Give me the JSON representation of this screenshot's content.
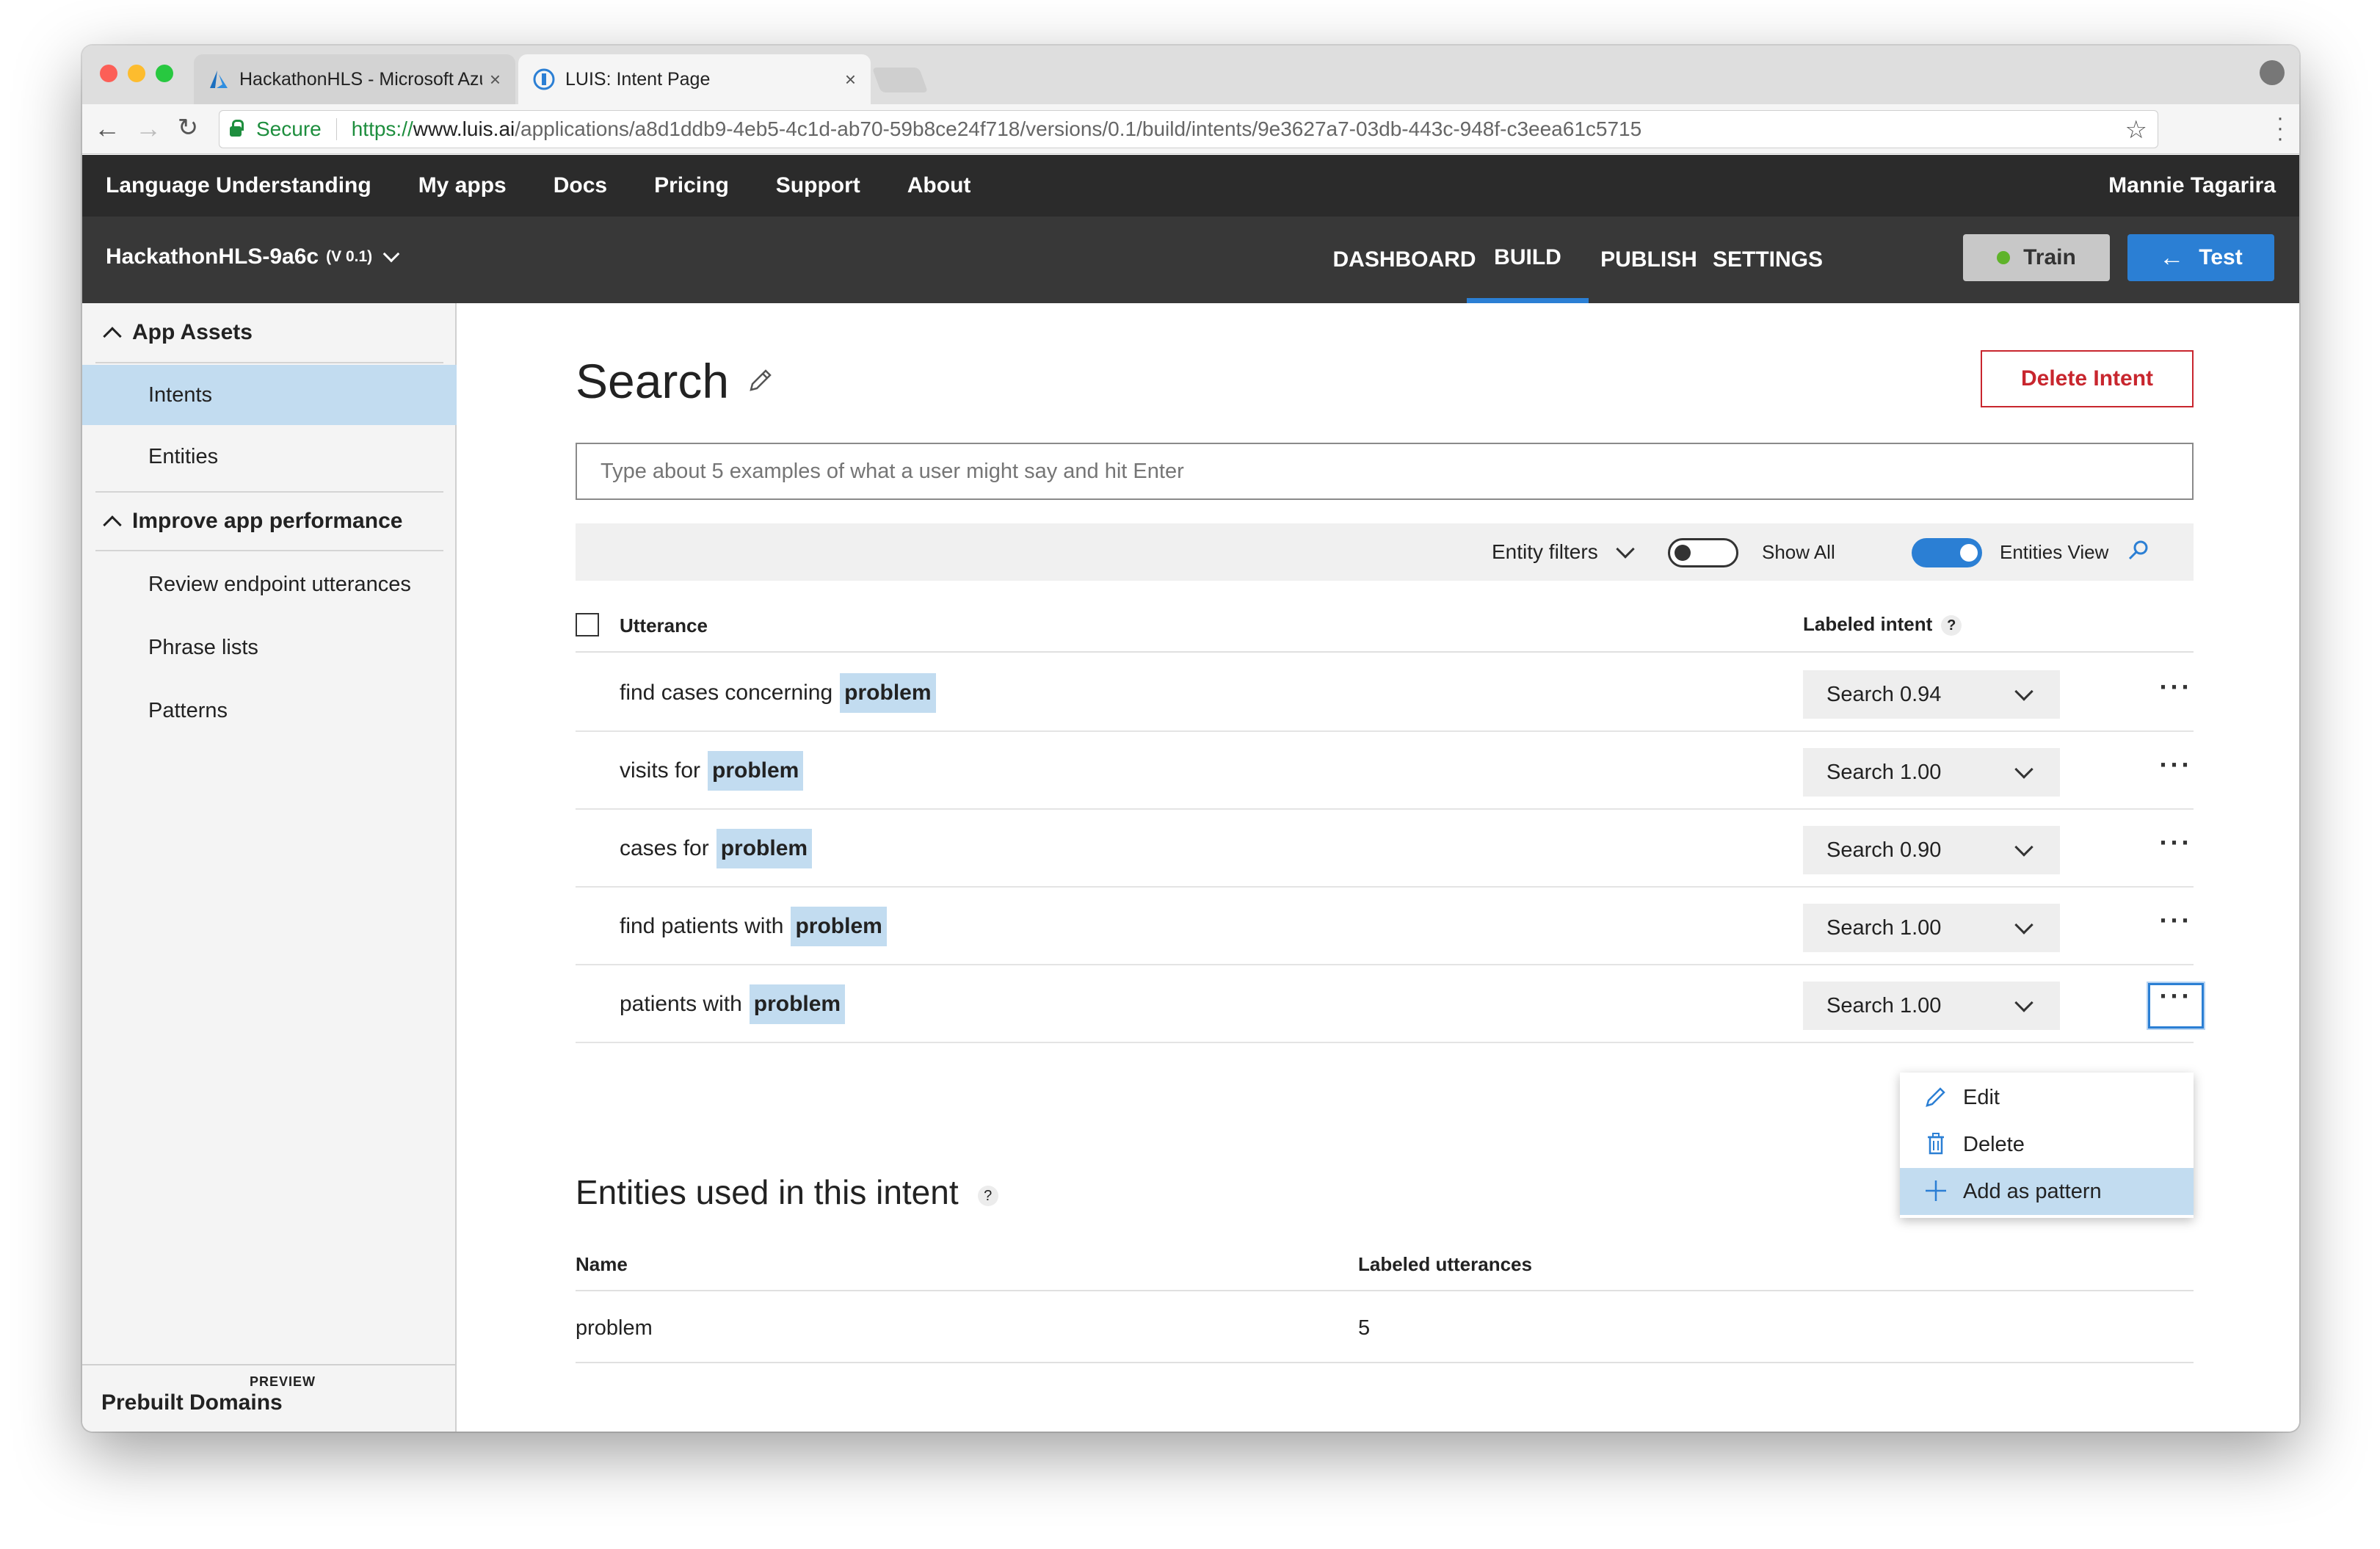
{
  "browser": {
    "tabs": [
      {
        "title": "HackathonHLS - Microsoft Azu",
        "icon": "azure-icon",
        "active": false
      },
      {
        "title": "LUIS: Intent Page",
        "icon": "luis-icon",
        "active": true
      }
    ],
    "close_glyph": "×",
    "secure_label": "Secure",
    "url": {
      "scheme": "https://",
      "host": "www.luis.ai",
      "path": "/applications/a8d1ddb9-4eb5-4c1d-ab70-59b8ce24f718/versions/0.1/build/intents/9e3627a7-03db-443c-948f-c3eea61c5715"
    },
    "star_glyph": "☆"
  },
  "topnav": {
    "items": [
      "Language Understanding",
      "My apps",
      "Docs",
      "Pricing",
      "Support",
      "About"
    ],
    "user": "Mannie Tagarira"
  },
  "subnav": {
    "app_name": "HackathonHLS-9a6c",
    "version": "(V 0.1)",
    "items": [
      "DASHBOARD",
      "BUILD",
      "PUBLISH",
      "SETTINGS"
    ],
    "active_item": "BUILD",
    "train_label": "Train",
    "test_label": "Test",
    "test_arrow": "←"
  },
  "sidebar": {
    "sections": [
      {
        "label": "App Assets",
        "items": [
          "Intents",
          "Entities"
        ]
      },
      {
        "label": "Improve app performance",
        "items": [
          "Review endpoint utterances",
          "Phrase lists",
          "Patterns"
        ]
      }
    ],
    "active_item": "Intents",
    "footer_label": "Prebuilt Domains",
    "footer_badge": "PREVIEW"
  },
  "main": {
    "title": "Search",
    "delete_button": "Delete Intent",
    "input_placeholder": "Type about 5 examples of what a user might say and hit Enter",
    "filters": {
      "entity_filters": "Entity filters",
      "show_all": "Show All",
      "show_all_on": false,
      "entities_view": "Entities View",
      "entities_view_on": true
    },
    "table": {
      "col_utterance": "Utterance",
      "col_intent": "Labeled intent",
      "help_glyph": "?",
      "ellipsis": "···",
      "rows": [
        {
          "text": "find cases concerning",
          "entity": "problem",
          "intent": "Search 0.94"
        },
        {
          "text": "visits for",
          "entity": "problem",
          "intent": "Search 1.00"
        },
        {
          "text": "cases for",
          "entity": "problem",
          "intent": "Search 0.90"
        },
        {
          "text": "find patients with",
          "entity": "problem",
          "intent": "Search 1.00"
        },
        {
          "text": "patients with",
          "entity": "problem",
          "intent": "Search 1.00"
        }
      ]
    },
    "context_menu": {
      "items": [
        "Edit",
        "Delete",
        "Add as pattern"
      ],
      "highlighted": "Add as pattern"
    },
    "entities_section": {
      "title": "Entities used in this intent",
      "col_name": "Name",
      "col_count": "Labeled utterances",
      "rows": [
        {
          "name": "problem",
          "count": "5"
        }
      ]
    }
  },
  "colors": {
    "accent": "#2b7fd4",
    "danger": "#c8262e",
    "highlight": "#c2dcf0",
    "topnav_bg": "#2b2b2b",
    "subnav_bg": "#383838",
    "train_dot": "#5fb32a"
  }
}
